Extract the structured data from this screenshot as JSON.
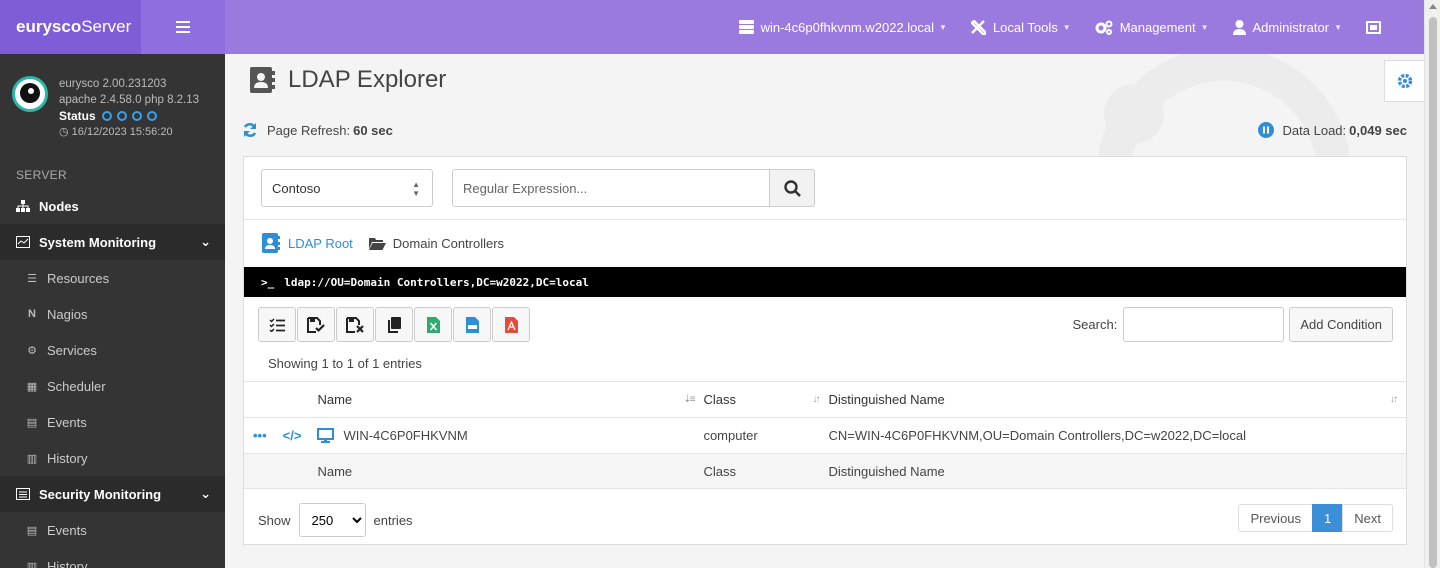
{
  "brand": {
    "bold": "eurysco",
    "thin": "Server"
  },
  "topnav": {
    "host": "win-4c6p0fhkvnm.w2022.local",
    "local_tools": "Local Tools",
    "management": "Management",
    "user": "Administrator"
  },
  "profile": {
    "version": "eurysco 2.00.231203",
    "stack": "apache 2.4.58.0  php 8.2.13",
    "status_label": "Status",
    "timestamp": "16/12/2023 15:56:20"
  },
  "sidebar": {
    "section": "SERVER",
    "nodes": "Nodes",
    "system_monitoring": "System Monitoring",
    "system_items": [
      "Resources",
      "Nagios",
      "Services",
      "Scheduler",
      "Events",
      "History"
    ],
    "security_monitoring": "Security Monitoring",
    "security_items": [
      "Events",
      "History"
    ]
  },
  "page": {
    "title": "LDAP Explorer",
    "refresh_label": "Page Refresh:",
    "refresh_value": "60 sec",
    "dataload_label": "Data Load:",
    "dataload_value": "0,049 sec"
  },
  "filters": {
    "domain": "Contoso",
    "regex_placeholder": "Regular Expression..."
  },
  "breadcrumb": {
    "root": "LDAP Root",
    "current": "Domain Controllers"
  },
  "ldap_path": "ldap://OU=Domain Controllers,DC=w2022,DC=local",
  "table": {
    "search_label": "Search:",
    "add_condition": "Add Condition",
    "showing": "Showing 1 to 1 of 1 entries",
    "headers": [
      "Name",
      "Class",
      "Distinguished Name"
    ],
    "rows": [
      {
        "name": "WIN-4C6P0FHKVNM",
        "class": "computer",
        "dn": "CN=WIN-4C6P0FHKVNM,OU=Domain Controllers,DC=w2022,DC=local"
      }
    ],
    "show_label": "Show",
    "page_length": "250",
    "entries_label": "entries",
    "prev": "Previous",
    "page": "1",
    "next": "Next"
  },
  "colors": {
    "topbar": "#9b7ae0",
    "brand": "#7e5dd6",
    "sidebar": "#343434",
    "accent": "#2e8fd6"
  }
}
